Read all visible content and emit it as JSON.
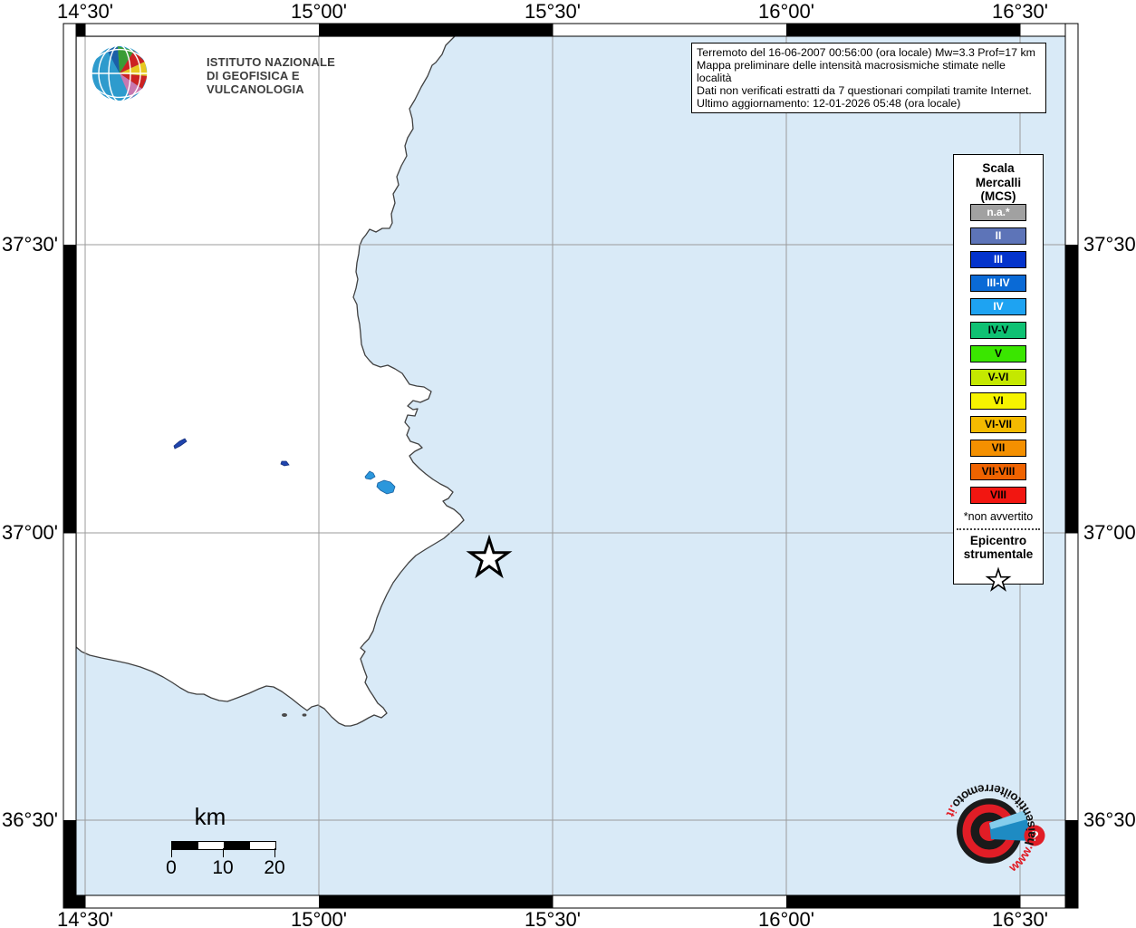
{
  "axis": {
    "lon": [
      "14°30'",
      "15°00'",
      "15°30'",
      "16°00'",
      "16°30'"
    ],
    "lat": [
      "37°30'",
      "37°00'",
      "36°30'"
    ]
  },
  "header": {
    "ingv_line1": "ISTITUTO NAZIONALE",
    "ingv_line2": "DI GEOFISICA E VULCANOLOGIA"
  },
  "info_box": {
    "line1": "Terremoto del 16-06-2007 00:56:00 (ora locale) Mw=3.3 Prof=17 km",
    "line2": "Mappa preliminare delle intensità macrosismiche stimate nelle località",
    "line3": "Dati non verificati estratti da 7 questionari compilati tramite Internet.",
    "line4": "Ultimo aggiornamento: 12-01-2026 05:48 (ora locale)"
  },
  "legend": {
    "title1": "Scala",
    "title2": "Mercalli",
    "title3": "(MCS)",
    "items": [
      {
        "label": "n.a.*",
        "color": "#a1a1a1",
        "text": "#ffffff"
      },
      {
        "label": "II",
        "color": "#5d74b8",
        "text": "#ffffff"
      },
      {
        "label": "III",
        "color": "#0433cc",
        "text": "#ffffff"
      },
      {
        "label": "III-IV",
        "color": "#0a6ad6",
        "text": "#ffffff"
      },
      {
        "label": "IV",
        "color": "#1ea3f2",
        "text": "#ffffff"
      },
      {
        "label": "IV-V",
        "color": "#0fc173",
        "text": "#000000"
      },
      {
        "label": "V",
        "color": "#3ae600",
        "text": "#000000"
      },
      {
        "label": "V-VI",
        "color": "#c4e800",
        "text": "#000000"
      },
      {
        "label": "VI",
        "color": "#f6f400",
        "text": "#000000"
      },
      {
        "label": "VI-VII",
        "color": "#f4ba00",
        "text": "#000000"
      },
      {
        "label": "VII",
        "color": "#f49000",
        "text": "#000000"
      },
      {
        "label": "VII-VIII",
        "color": "#ef6300",
        "text": "#000000"
      },
      {
        "label": "VIII",
        "color": "#f21611",
        "text": "#000000"
      }
    ],
    "footnote": "*non avvertito",
    "epi1": "Epicentro",
    "epi2": "strumentale"
  },
  "scalebar": {
    "unit": "km",
    "t0": "0",
    "t1": "10",
    "t2": "20"
  },
  "watermark": {
    "pre": "www.",
    "mid": "haisentitoilterremoto",
    "suf": ".it",
    "q": "?"
  },
  "colors": {
    "sea": "#d9eaf7",
    "land": "#ffffff",
    "coast": "#404040",
    "grid": "#9b9b9b",
    "lake": "#2b97dc",
    "lake_dark": "#1f44ad",
    "logo_red": "#e11d26",
    "logo_blue": "#1e8bc3"
  }
}
